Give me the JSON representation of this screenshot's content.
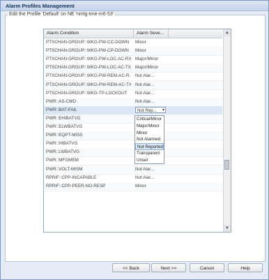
{
  "window": {
    "title": "Alarm Profiles Management"
  },
  "panel": {
    "legend": "Edit the Profile 'Default' on NE 'nmtg-tme-m6-53'"
  },
  "grid": {
    "columns": [
      "Alarm Condition",
      "Alarm Seve..."
    ],
    "rows": [
      {
        "condition": "PTSCHAN-GROUP::WKG-PW-CC-DOWN",
        "severity": "Minor"
      },
      {
        "condition": "PTSCHAN-GROUP::WKG-PW-CP-DOWN",
        "severity": "Minor"
      },
      {
        "condition": "PTSCHAN-GROUP::WKG-PW-LOC-AC-RX...",
        "severity": "Major/Minor"
      },
      {
        "condition": "PTSCHAN-GROUP::WKG-PW-LOC-AC-TX...",
        "severity": "Major/Minor"
      },
      {
        "condition": "PTSCHAN-GROUP::WKG-PW-REM-AC-R...",
        "severity": "Not Alar..."
      },
      {
        "condition": "PTSCHAN-GROUP::WKG-PW-REM-AC-TX...",
        "severity": "Not Alar..."
      },
      {
        "condition": "PTSCHAN-GROUP::WKG-TP-LOCKOUT",
        "severity": "Not Alar..."
      },
      {
        "condition": "PWR::AS-CMD",
        "severity": "Not Alar..."
      },
      {
        "condition": "PWR::BAT-FAIL",
        "severity": "Not Rep..."
      },
      {
        "condition": "PWR::EHIBATVG",
        "severity": ""
      },
      {
        "condition": "PWR::ELWBATVG",
        "severity": ""
      },
      {
        "condition": "PWR::EQPT-MISS",
        "severity": ""
      },
      {
        "condition": "PWR::HIBATVG",
        "severity": ""
      },
      {
        "condition": "PWR::LWBATVG",
        "severity": ""
      },
      {
        "condition": "PWR::MFGMEM",
        "severity": ""
      },
      {
        "condition": "PWR::VOLT-MISM",
        "severity": "Not Alar..."
      },
      {
        "condition": "RPRIF::CPP-INCAPABLE",
        "severity": "Not Alar..."
      },
      {
        "condition": "RPRIF::CPP-PEER-NO-RESP",
        "severity": "Minor"
      }
    ],
    "selected_row": 8,
    "combo_value": "Not Rep...",
    "options": [
      "Critical/Minor",
      "Major/Minor",
      "Minor",
      "Not Alarmed",
      "Not Reported",
      "Transparent",
      "Unset"
    ],
    "highlighted_option": "Not Reported"
  },
  "buttons": {
    "back": "<< Back",
    "next": "Next >>",
    "cancel": "Cancel",
    "help": "Help"
  }
}
